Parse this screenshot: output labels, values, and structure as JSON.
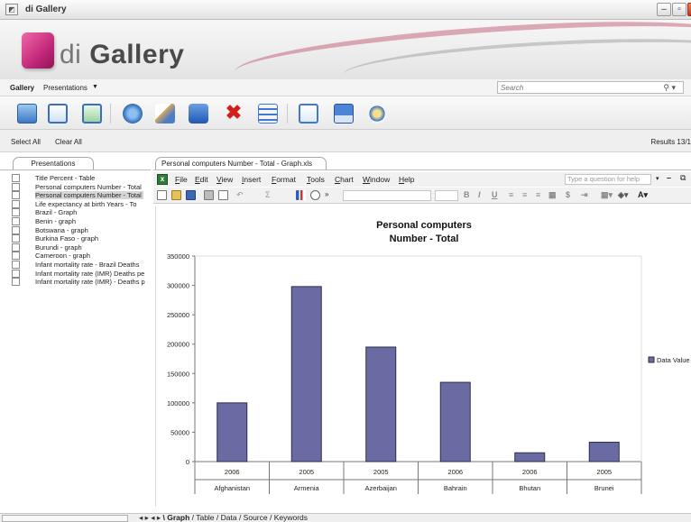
{
  "window": {
    "title": "di Gallery"
  },
  "banner": {
    "logo_prefix": "di",
    "logo_word": "Gallery"
  },
  "nav": {
    "gallery": "Gallery",
    "presentations": "Presentations",
    "search_placeholder": "Search"
  },
  "selectbar": {
    "select_all": "Select All",
    "clear_all": "Clear All",
    "results": "Results 13/1"
  },
  "left_tab": "Presentations",
  "presentations": [
    {
      "label": "Title Percent - Table",
      "selected": false
    },
    {
      "label": "Personal computers Number - Total",
      "selected": false
    },
    {
      "label": "Personal computers Number - Total",
      "selected": true
    },
    {
      "label": "Life expectancy at birth Years - To",
      "selected": false
    },
    {
      "label": "Brazil - Graph",
      "selected": false
    },
    {
      "label": "Benin - graph",
      "selected": false
    },
    {
      "label": "Botswana - graph",
      "selected": false
    },
    {
      "label": "Burkina Faso - graph",
      "selected": false
    },
    {
      "label": "Burundi - graph",
      "selected": false
    },
    {
      "label": "Cameroon - graph",
      "selected": false
    },
    {
      "label": "Infant mortality rate - Brazil Deaths",
      "selected": false
    },
    {
      "label": "Infant mortality rate (IMR) Deaths pe",
      "selected": false
    },
    {
      "label": "Infant mortality rate (IMR) - Deaths p",
      "selected": false
    }
  ],
  "doc_tab": "Personal computers Number - Total - Graph.xls",
  "menu": [
    "File",
    "Edit",
    "View",
    "Insert",
    "Format",
    "Tools",
    "Chart",
    "Window",
    "Help"
  ],
  "help_box": "Type a question for help",
  "sheet_tabs": [
    "Graph",
    "Table",
    "Data",
    "Source",
    "Keywords"
  ],
  "chart_data": {
    "type": "bar",
    "title": "Personal computers",
    "subtitle": "Number - Total",
    "categories": [
      "Afghanistan",
      "Armenia",
      "Azerbaijan",
      "Bahrain",
      "Bhutan",
      "Brunei"
    ],
    "years": [
      "2006",
      "2005",
      "2005",
      "2006",
      "2006",
      "2005"
    ],
    "series": [
      {
        "name": "Data Value",
        "values": [
          100000,
          298000,
          195000,
          135000,
          15000,
          33000
        ]
      }
    ],
    "ylim": [
      0,
      350000
    ],
    "yticks": [
      "350000",
      "300000",
      "250000",
      "200000",
      "150000",
      "100000",
      "50000",
      "0"
    ],
    "colors": {
      "bar": "#6b6ba4",
      "bar_edge": "#2d2d4a"
    },
    "legend": "right",
    "grid": false
  }
}
